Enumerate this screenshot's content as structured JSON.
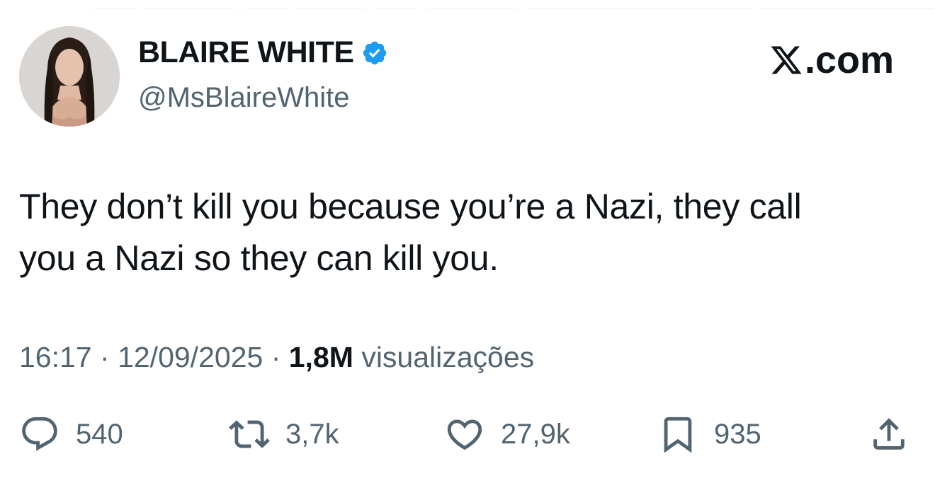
{
  "tweet": {
    "display_name": "BLAIRE WHITE",
    "handle": "@MsBlaireWhite",
    "source": ".com",
    "text_line1": "They don’t kill you because you’re a Nazi, they call",
    "text_line2": "you a Nazi so they can kill you.",
    "time": "16:17",
    "separator": "·",
    "date": "12/09/2025",
    "views_count": "1,8M",
    "views_label": "visualizações"
  },
  "actions": {
    "replies": "540",
    "reposts": "3,7k",
    "likes": "27,9k",
    "bookmarks": "935"
  },
  "icons": {
    "verified": "verified-badge-icon",
    "x_logo": "x-logo-icon",
    "reply": "reply-icon",
    "repost": "repost-icon",
    "like": "heart-icon",
    "bookmark": "bookmark-icon",
    "share": "share-icon"
  },
  "colors": {
    "verified_blue": "#1d9bf0",
    "text_primary": "#0f1419",
    "text_secondary": "#536471"
  }
}
